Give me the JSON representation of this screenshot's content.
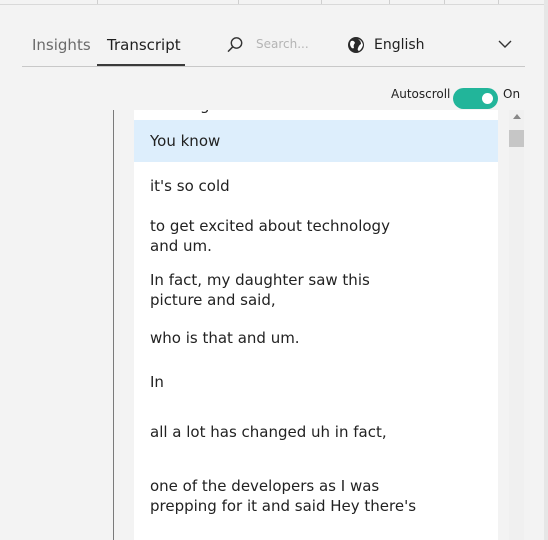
{
  "tabs": [
    {
      "label": "Insights",
      "active": false
    },
    {
      "label": "Transcript",
      "active": true
    }
  ],
  "search": {
    "placeholder": "Search..."
  },
  "language": {
    "label": "English",
    "icon": "globe-icon"
  },
  "autoscroll": {
    "label": "Autoscroll",
    "state": "On",
    "enabled": true,
    "color": "#22b59a"
  },
  "transcript": {
    "partial_top": "working",
    "segments": [
      {
        "text": "You know",
        "active": true
      },
      {
        "text": "it's so cold",
        "active": false
      },
      {
        "text": "to get excited about technology\nand um.",
        "active": false
      },
      {
        "text": "In fact, my daughter saw this\npicture and said,",
        "active": false
      },
      {
        "text": "who is that and um.",
        "active": false
      },
      {
        "text": "In",
        "active": false
      },
      {
        "text": "all a lot has changed uh in fact,",
        "active": false
      },
      {
        "text": "one of the developers as I was\nprepping for it and said Hey there's",
        "active": false
      }
    ]
  },
  "colors": {
    "active_segment": "#ddeefc",
    "toggle_on": "#22b59a"
  }
}
